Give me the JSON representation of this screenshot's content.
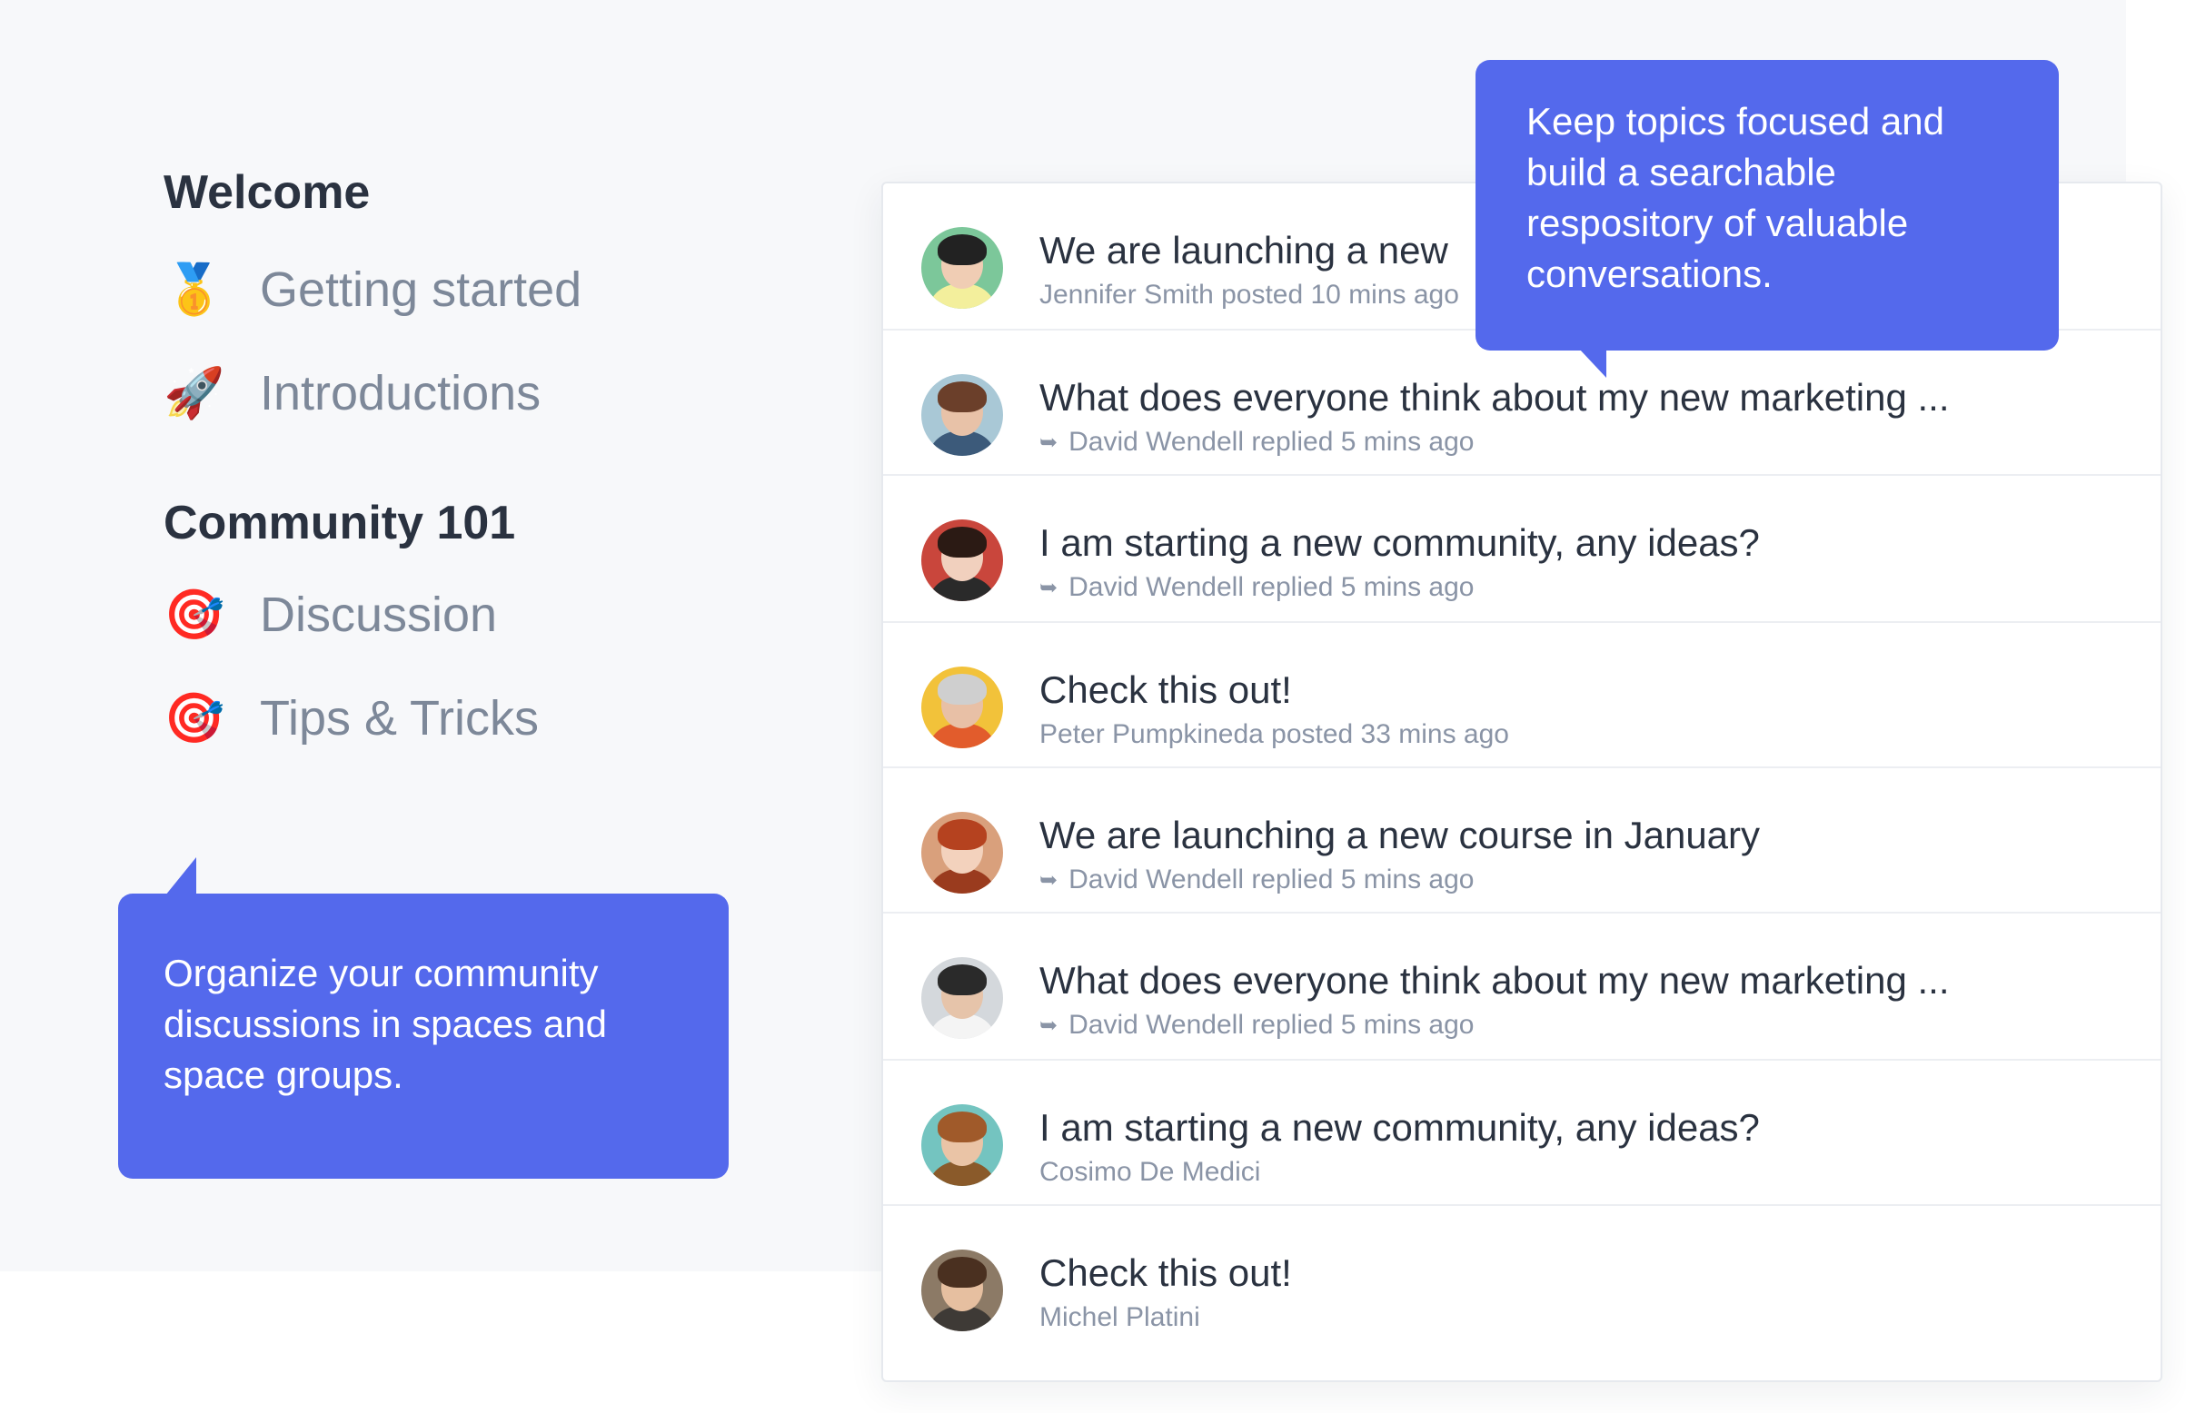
{
  "sidebar": {
    "groups": [
      {
        "title": "Welcome",
        "items": [
          {
            "emoji": "🥇",
            "icon": "medal-icon",
            "label": "Getting started"
          },
          {
            "emoji": "🚀",
            "icon": "rocket-icon",
            "label": "Introductions"
          }
        ]
      },
      {
        "title": "Community 101",
        "items": [
          {
            "emoji": "🎯",
            "icon": "target-icon",
            "label": "Discussion"
          },
          {
            "emoji": "🎯",
            "icon": "target-icon",
            "label": "Tips & Tricks"
          }
        ]
      }
    ]
  },
  "tooltips": {
    "left": "Organize your community discussions in spaces and space groups.",
    "right": "Keep topics focused and build a searchable respository of valuable conversations."
  },
  "posts": [
    {
      "title": "We are launching a new",
      "meta": "Jennifer Smith posted 10 mins ago",
      "reply": false
    },
    {
      "title": "What does everyone think about my new marketing ...",
      "meta": "David Wendell replied 5 mins ago",
      "reply": true
    },
    {
      "title": "I am starting a new community, any ideas?",
      "meta": "David Wendell replied 5 mins ago",
      "reply": true
    },
    {
      "title": "Check this out!",
      "meta": "Peter Pumpkineda posted 33 mins ago",
      "reply": false
    },
    {
      "title": "We are launching a new course in January",
      "meta": "David Wendell replied 5 mins ago",
      "reply": true
    },
    {
      "title": "What does everyone think about my new marketing ...",
      "meta": "David Wendell replied 5 mins ago",
      "reply": true
    },
    {
      "title": "I am starting a new community, any ideas?",
      "meta": "Cosimo De Medici",
      "reply": false
    },
    {
      "title": "Check this out!",
      "meta": "Michel Platini",
      "reply": false
    }
  ],
  "colors": {
    "accent": "#5469ec",
    "heading": "#2a3240",
    "muted": "#8a94a6"
  }
}
